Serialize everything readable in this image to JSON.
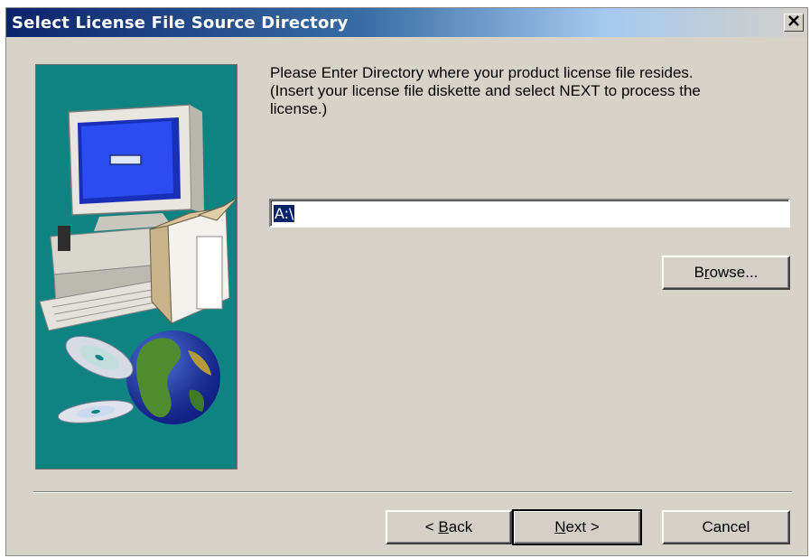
{
  "window": {
    "title": "Select License File Source Directory",
    "close_glyph": "✕"
  },
  "prompt": {
    "line1": "Please Enter Directory where your product license file resides.",
    "line2": "(Insert your license file diskette and select NEXT to process the",
    "line3": "license.)"
  },
  "directory_field": {
    "value": "A:\\"
  },
  "buttons": {
    "browse_pre": "B",
    "browse_ul": "r",
    "browse_post": "owse...",
    "back_pre": "< ",
    "back_ul": "B",
    "back_post": "ack",
    "next_pre": "",
    "next_ul": "N",
    "next_post": "ext >",
    "cancel": "Cancel"
  },
  "side_image": {
    "icons": [
      "computer-icon",
      "box-icon",
      "cd-icon",
      "globe-icon"
    ]
  },
  "colors": {
    "title_bar_start": "#0a246a",
    "panel_background": "#0f8382",
    "dialog_face": "#d8d3c8",
    "selection": "#0a246a"
  }
}
